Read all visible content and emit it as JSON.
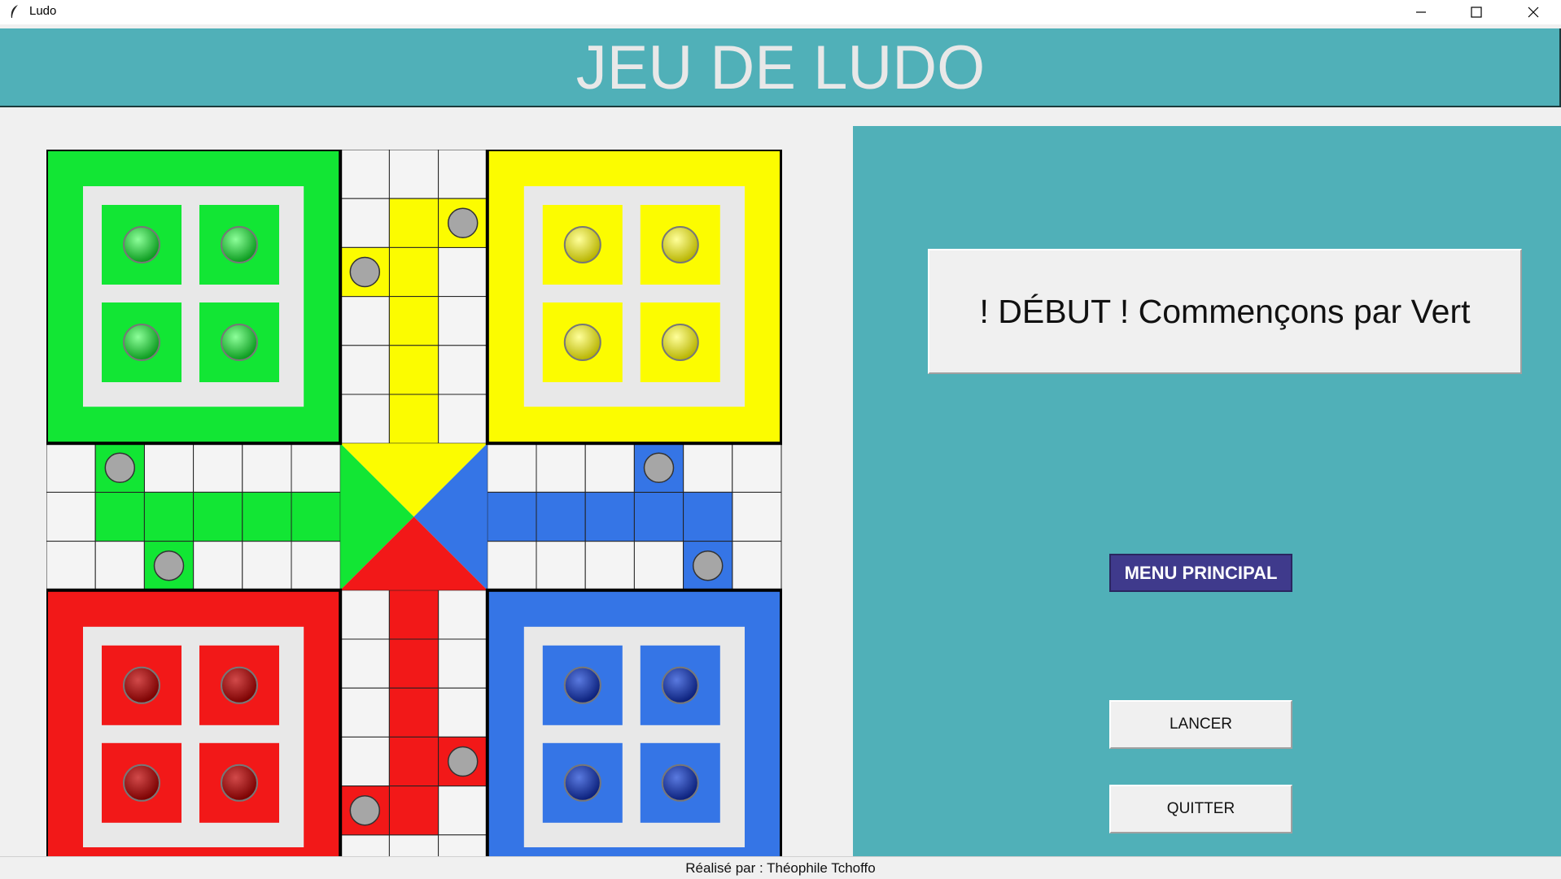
{
  "window": {
    "title": "Ludo"
  },
  "header": {
    "title": "JEU DE LUDO"
  },
  "status": {
    "message": "! DÉBUT ! Commençons par Vert"
  },
  "buttons": {
    "menu": "MENU PRINCIPAL",
    "roll": "LANCER",
    "quit": "QUITTER"
  },
  "footer": {
    "credit": "Réalisé par : Théophile Tchoffo"
  },
  "colors": {
    "green": "#12e634",
    "yellow": "#fcfc00",
    "red": "#f21818",
    "blue": "#3575e6",
    "panel": "#50b0b8",
    "safe_spot": "#a6a6a6"
  },
  "icons": {
    "app": "feather-icon",
    "minimize": "minimize-icon",
    "maximize": "maximize-icon",
    "close": "close-icon",
    "token": "ludo-token-icon",
    "safe": "safe-spot-icon"
  },
  "players": [
    {
      "name": "green",
      "corner": "top-left",
      "tokens_in_base": 4
    },
    {
      "name": "yellow",
      "corner": "top-right",
      "tokens_in_base": 4
    },
    {
      "name": "red",
      "corner": "bottom-left",
      "tokens_in_base": 4
    },
    {
      "name": "blue",
      "corner": "bottom-right",
      "tokens_in_base": 4
    }
  ]
}
